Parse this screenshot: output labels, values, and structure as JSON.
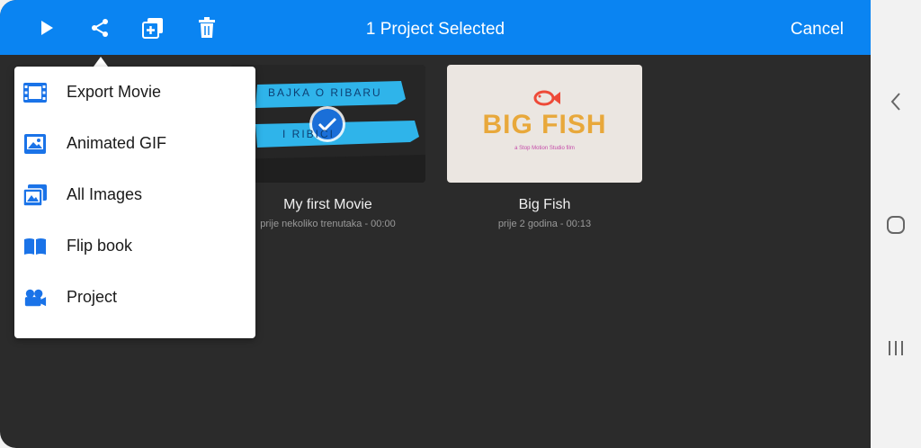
{
  "header": {
    "title": "1 Project Selected",
    "cancel_label": "Cancel"
  },
  "icons": {
    "play": "play-icon",
    "share": "share-icon",
    "duplicate": "duplicate-icon",
    "delete": "trash-icon"
  },
  "share_menu": {
    "items": [
      {
        "label": "Export Movie",
        "icon": "film-icon"
      },
      {
        "label": "Animated GIF",
        "icon": "image-icon"
      },
      {
        "label": "All Images",
        "icon": "images-icon"
      },
      {
        "label": "Flip book",
        "icon": "book-icon"
      },
      {
        "label": "Project",
        "icon": "camera-icon"
      }
    ]
  },
  "projects": [
    {
      "title": "My first Movie",
      "subtitle": "prije nekoliko trenutaka - 00:00",
      "selected": true,
      "thumb_text_1": "BAJKA O RIBARU",
      "thumb_text_2": "I RIBICI"
    },
    {
      "title": "Big Fish",
      "subtitle": "prije 2 godina - 00:13",
      "selected": false,
      "thumb_title": "BIG FISH",
      "thumb_caption": "a Stop Motion Studio film"
    }
  ],
  "colors": {
    "accent": "#0a84f2",
    "background": "#2b2b2b",
    "menu": "#ffffff"
  },
  "system_nav": {
    "back": "back-icon",
    "home": "home-icon",
    "recents": "recents-icon"
  }
}
